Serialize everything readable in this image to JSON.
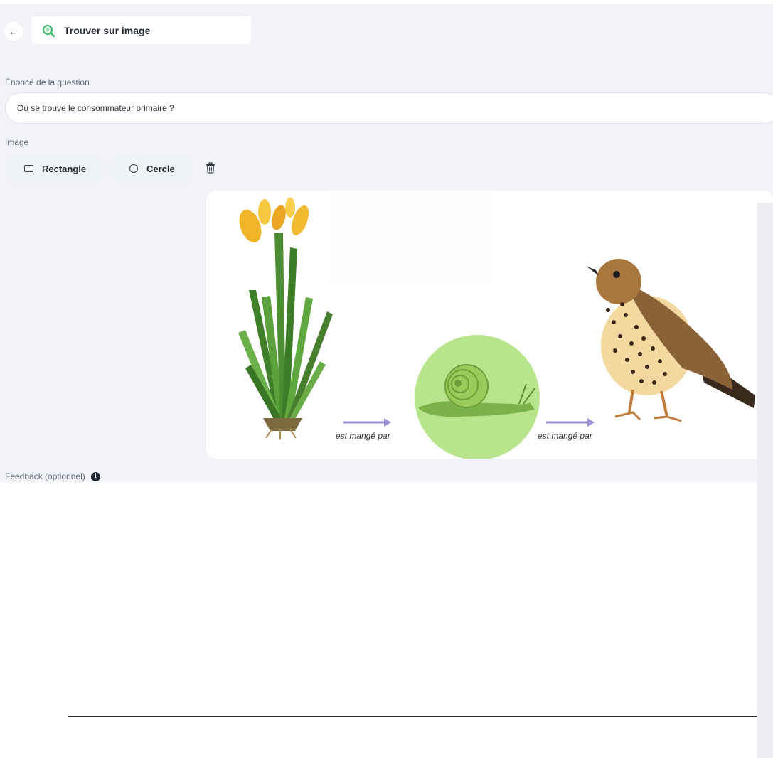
{
  "header": {
    "back_icon": "arrow-left-icon",
    "type_icon": "search-image-icon",
    "type_label": "Trouver sur image"
  },
  "question": {
    "label": "Énoncé de la question",
    "value": "Où se trouve le consommateur primaire ?"
  },
  "image_section": {
    "label": "Image",
    "rectangle_label": "Rectangle",
    "circle_label": "Cercle",
    "trash_icon": "trash-icon",
    "arrow_caption_1": "est mangé par",
    "arrow_caption_2": "est mangé par",
    "zone_color": "#b8e58c"
  },
  "feedback": {
    "label": "Feedback (optionnel)",
    "info_icon": "info-icon",
    "value": ""
  }
}
